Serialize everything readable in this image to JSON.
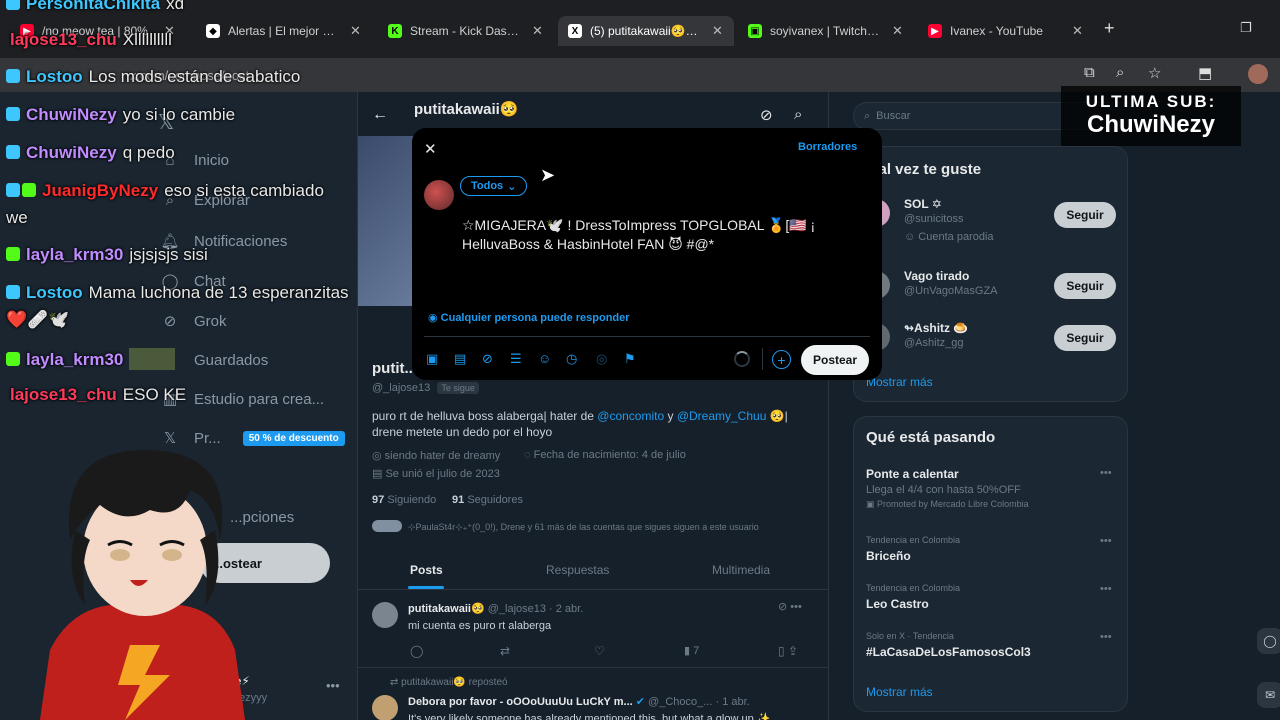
{
  "browser": {
    "tabs": [
      {
        "title": "/no meow tea | 80%",
        "color": "#ff0033",
        "glyph": "▶"
      },
      {
        "title": "Alertas | El mejor soft",
        "color": "#ffffff",
        "glyph": "◆"
      },
      {
        "title": "Stream - Kick Dashbo",
        "color": "#53fc18",
        "glyph": "K"
      },
      {
        "title": "(5) putitakawaii🥺 (@",
        "color": "#ffffff",
        "glyph": "X"
      },
      {
        "title": "soyivanex | Twitch | L",
        "color": "#53fc18",
        "glyph": "▣"
      },
      {
        "title": "Ivanex - YouTube",
        "color": "#ff0033",
        "glyph": "▶"
      }
    ],
    "url": "x.com/compose/post"
  },
  "nav": {
    "items": [
      "Inicio",
      "Explorar",
      "Notificaciones",
      "Chat",
      "Grok",
      "Guardados",
      "Estudio para crea...",
      "Pr...",
      "...pciones"
    ],
    "premium_badge": "50 % de descuento",
    "post_button": "...ostear",
    "account_name": "...rene⚡",
    "account_handle": "...Drenezyyy"
  },
  "profile": {
    "header_name": "putitakawaii🥺",
    "name_short": "putit...",
    "handle": "@_lajose13",
    "follows_you": "Te sigue",
    "bio_pre": "puro rt de helluva boss alaberga| hater de ",
    "bio_mention1": "@concomito",
    "bio_mid": " y ",
    "bio_mention2": "@Dreamy_Chuu",
    "bio_post": " 🥺| drene metete un dedo por el hoyo",
    "location": "siendo hater de dreamy",
    "birthday": "Fecha de nacimiento: 4 de julio",
    "joined": "Se unió el julio de 2023",
    "following_count": "97",
    "following_label": "Siguiendo",
    "followers_count": "91",
    "followers_label": "Seguidores",
    "followed_by": "⊹PaulaSt4r⊹₊⁺(0_0!), Drene y 61 más de las cuentas que sigues siguen a este usuario",
    "tabs": [
      "Posts",
      "Respuestas",
      "Multimedia"
    ]
  },
  "posts": [
    {
      "name": "putitakawaii🥺",
      "handle": "@_lajose13 · 2 abr.",
      "text": "mi cuenta es puro rt alaberga",
      "views": "7"
    },
    {
      "reposted": "putitakawaii🥺 reposteó",
      "name": "Debora por favor - oOOoUuuUu LuCkY m...",
      "handle": "@_Choco_... · 1 abr.",
      "text": "It's very likely someone has already mentioned this, but what a glow up ✨"
    }
  ],
  "right": {
    "search_placeholder": "Buscar",
    "suggest_title": "...al vez te guste",
    "suggestions": [
      {
        "name": "SOL ✡",
        "handle": "@sunicitoss",
        "note": "Cuenta parodia",
        "button": "Seguir"
      },
      {
        "name": "Vago tirado",
        "handle": "@UnVagoMasGZA",
        "note": "",
        "button": "Seguir"
      },
      {
        "name": "↬Ashitz 🍮",
        "handle": "@Ashitz_gg",
        "note": "",
        "button": "Seguir"
      }
    ],
    "show_more": "Mostrar más",
    "trends_title": "Qué está pasando",
    "trends": [
      {
        "title": "Ponte a calentar",
        "sub": "Llega el 4/4 con hasta 50%OFF",
        "meta": "Promoted by Mercado Libre Colombia"
      },
      {
        "meta": "Tendencia en Colombia",
        "title": "Briceño"
      },
      {
        "meta": "Tendencia en Colombia",
        "title": "Leo Castro"
      },
      {
        "meta": "Solo en X · Tendencia",
        "title": "#LaCasaDeLosFamososCol3"
      }
    ],
    "trends_more": "Mostrar más"
  },
  "compose": {
    "drafts": "Borradores",
    "audience": "Todos",
    "text_line1": "☆MIGAJERA🕊️ ! DressToImpress TOPGLOBAL 🏅[🇺🇸 ¡",
    "text_line2": "HelluvaBoss & HasbinHotel FAN 😈 #@*",
    "reply_setting": "Cualquier persona puede responder",
    "post_button": "Postear"
  },
  "overlay": {
    "chat": [
      {
        "user": "PersonitaChikita",
        "msg": "xd",
        "color": "#3ec7ff"
      },
      {
        "user": "lajose13_chu",
        "msg": "Xllllllllll",
        "color": "#ff3b5c"
      },
      {
        "user": "Lostoo",
        "msg": "Los mods están de sabatico",
        "color": "#3ec7ff"
      },
      {
        "user": "ChuwiNezy",
        "msg": "yo si lo cambie",
        "color": "#c08cff"
      },
      {
        "user": "ChuwiNezy",
        "msg": "q pedo",
        "color": "#c08cff"
      },
      {
        "user": "JuanigByNezy",
        "msg": "eso si esta cambiado",
        "color": "#ff2b2b"
      },
      {
        "user": "",
        "msg": "we",
        "color": "#ffffff"
      },
      {
        "user": "layla_krm30",
        "msg": "jsjsjsjs sisi",
        "color": "#c08cff"
      },
      {
        "user": "Lostoo",
        "msg": "Mama luchona de 13 esperanzitas",
        "color": "#3ec7ff"
      },
      {
        "user": "",
        "msg": "❤️🩹🕊️",
        "color": "#ffffff"
      },
      {
        "user": "layla_krm30",
        "msg": "",
        "color": "#c08cff"
      },
      {
        "user": "lajose13_chu",
        "msg": "ESO KE",
        "color": "#ff3b5c"
      }
    ],
    "sub_label": "ULTIMA SUB:",
    "sub_name": "ChuwiNezy"
  }
}
